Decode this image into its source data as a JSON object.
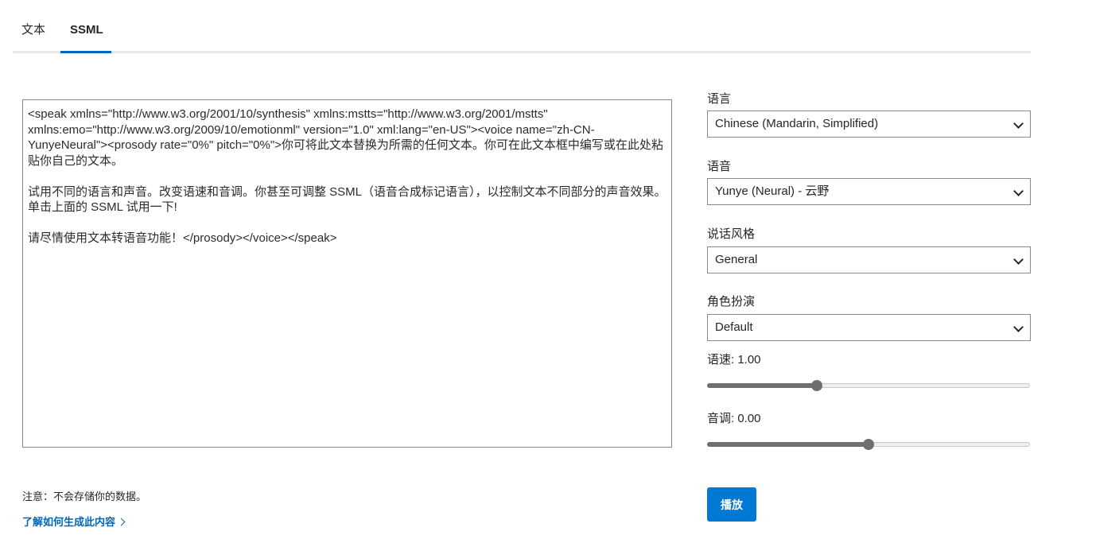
{
  "tabs": [
    {
      "label": "文本"
    },
    {
      "label": "SSML"
    }
  ],
  "active_tab": "SSML",
  "editor": {
    "content": "<speak xmlns=\"http://www.w3.org/2001/10/synthesis\" xmlns:mstts=\"http://www.w3.org/2001/mstts\" xmlns:emo=\"http://www.w3.org/2009/10/emotionml\" version=\"1.0\" xml:lang=\"en-US\"><voice name=\"zh-CN-YunyeNeural\"><prosody rate=\"0%\" pitch=\"0%\">你可将此文本替换为所需的任何文本。你可在此文本框中编写或在此处粘贴你自己的文本。\n\n试用不同的语言和声音。改变语速和音调。你甚至可调整 SSML（语音合成标记语言），以控制文本不同部分的声音效果。单击上面的 SSML 试用一下!\n\n请尽情使用文本转语音功能！</prosody></voice></speak>"
  },
  "notice": "注意：不会存储你的数据。",
  "learn_link": "了解如何生成此内容",
  "settings": {
    "language": {
      "label": "语言",
      "value": "Chinese (Mandarin, Simplified)"
    },
    "voice": {
      "label": "语音",
      "value": "Yunye (Neural) - 云野"
    },
    "style": {
      "label": "说话风格",
      "value": "General"
    },
    "role": {
      "label": "角色扮演",
      "value": "Default"
    },
    "rate": {
      "label": "语速: 1.00",
      "fraction": 0.34
    },
    "pitch": {
      "label": "音调: 0.00",
      "fraction": 0.5
    }
  },
  "play_button": "播放",
  "colors": {
    "accent": "#0078d4",
    "link": "#0067b8",
    "slider": "#6f6f6f"
  }
}
